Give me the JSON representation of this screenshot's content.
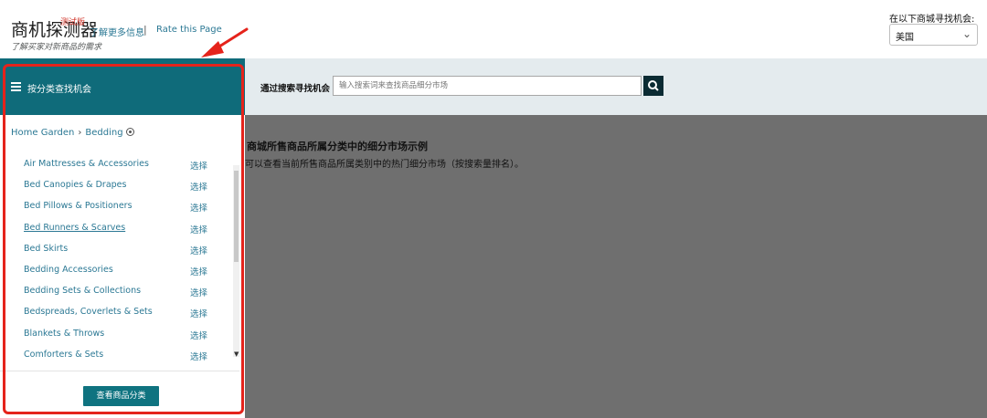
{
  "header": {
    "brand": "商机探测器",
    "beta_tag": "测试版",
    "subtitle": "了解买家对新商品的需求",
    "learn_more": "了解更多信息",
    "separator": "|",
    "rate_page": "Rate this Page",
    "region_label": "在以下商城寻找机会:",
    "region_selected": "美国"
  },
  "left_panel": {
    "title": "按分类查找机会",
    "breadcrumb": [
      "Home Garden",
      "Bedding"
    ],
    "categories": [
      {
        "name": "Air Mattresses & Accessories",
        "action": "选择"
      },
      {
        "name": "Bed Canopies & Drapes",
        "action": "选择"
      },
      {
        "name": "Bed Pillows & Positioners",
        "action": "选择"
      },
      {
        "name": "Bed Runners & Scarves",
        "action": "选择"
      },
      {
        "name": "Bed Skirts",
        "action": "选择"
      },
      {
        "name": "Bedding Accessories",
        "action": "选择"
      },
      {
        "name": "Bedding Sets & Collections",
        "action": "选择"
      },
      {
        "name": "Bedspreads, Coverlets & Sets",
        "action": "选择"
      },
      {
        "name": "Blankets & Throws",
        "action": "选择"
      },
      {
        "name": "Comforters & Sets",
        "action": "选择"
      }
    ],
    "view_button": "查看商品分类"
  },
  "search": {
    "label": "通过搜索寻找机会",
    "placeholder": "输入搜索词来查找商品细分市场"
  },
  "main": {
    "title": "商城所售商品所属分类中的细分市场示例",
    "description": "可以查看当前所售商品所属类别中的热门细分市场（按搜索量排名）。"
  },
  "colors": {
    "panel_header": "#0f6b7a",
    "link": "#2b7894",
    "highlight_annotation": "#e5231b",
    "search_button": "#0b2b33"
  }
}
